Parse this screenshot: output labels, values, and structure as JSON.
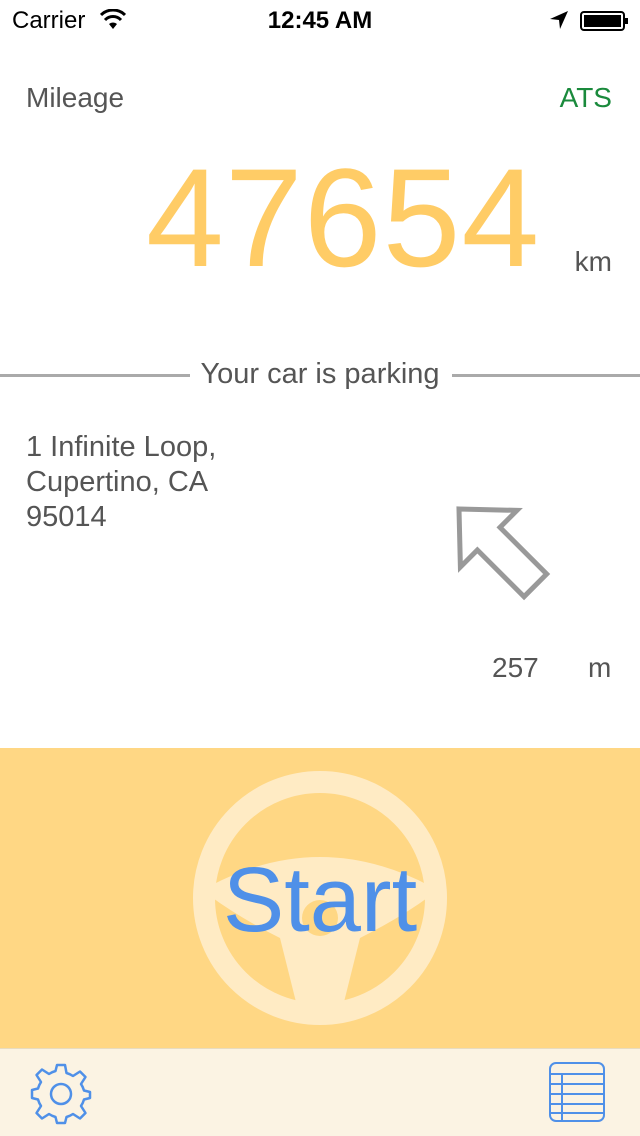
{
  "status_bar": {
    "carrier": "Carrier",
    "time": "12:45 AM",
    "wifi_icon": "wifi-icon",
    "location_icon": "location-arrow-icon",
    "battery_icon": "battery-full-icon"
  },
  "mileage": {
    "label": "Mileage",
    "brand": "ATS",
    "value": "47654",
    "unit": "km",
    "value_color": "#ffcc66",
    "brand_color": "#1a8a3c"
  },
  "parking": {
    "caption": "Your car is parking",
    "address_lines": [
      "1 Infinite Loop,",
      "Cupertino, CA",
      "95014"
    ],
    "direction_icon": "direction-arrow-icon",
    "distance_value": "257",
    "distance_unit": "m"
  },
  "start_panel": {
    "label": "Start",
    "background_color": "#ffd784",
    "label_color": "#4f90e8",
    "icon": "steering-wheel-icon"
  },
  "bottom_bar": {
    "settings_icon": "gear-icon",
    "list_icon": "list-icon"
  }
}
